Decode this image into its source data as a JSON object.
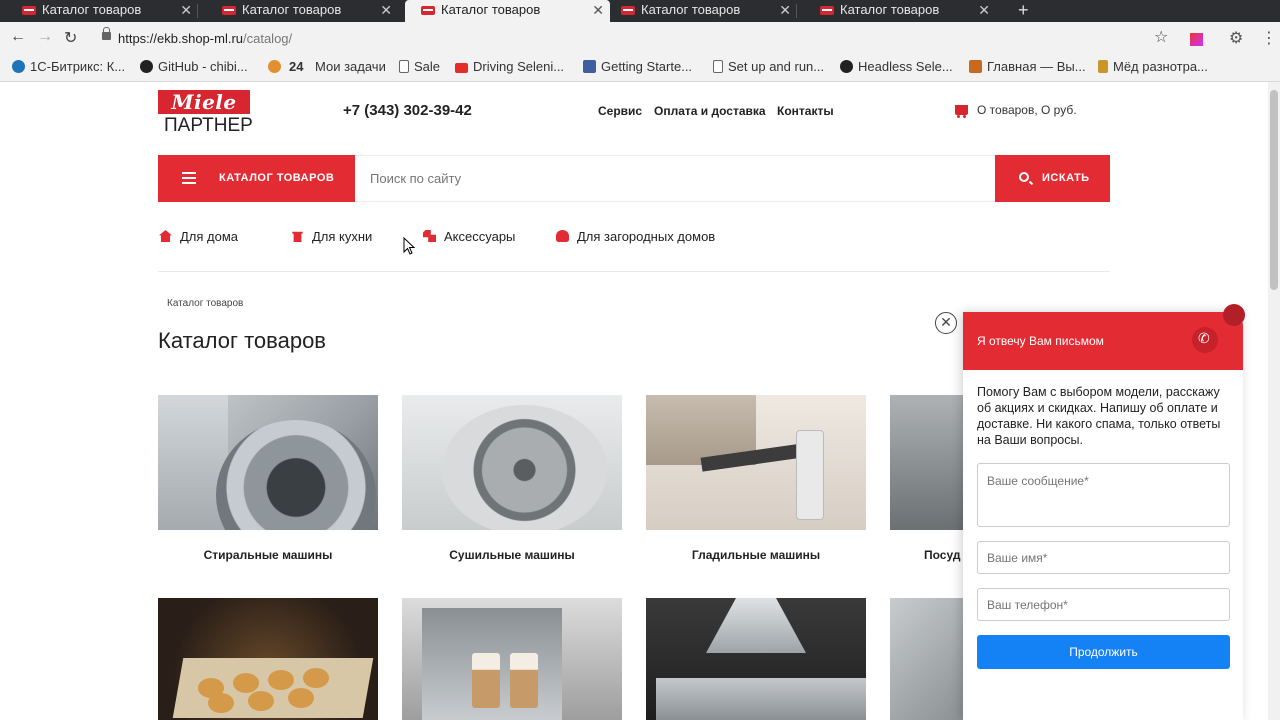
{
  "browser": {
    "tabs": [
      {
        "label": "Каталог товаров",
        "active": false
      },
      {
        "label": "Каталог товаров",
        "active": false
      },
      {
        "label": "Каталог товаров",
        "active": true
      },
      {
        "label": "Каталог товаров",
        "active": false
      },
      {
        "label": "Каталог товаров",
        "active": false
      }
    ],
    "new_tab": "+",
    "url_host": "https://ekb.shop-ml.ru",
    "url_path": "/catalog/",
    "bookmarks": [
      {
        "label": "1С-Битрикс: К...",
        "icon": "bitrix-icon",
        "color": "#1e74b8"
      },
      {
        "label": "GitHub - chibi...",
        "icon": "github-icon",
        "color": "#222222"
      },
      {
        "label": "24",
        "icon": "burger-icon",
        "color": "#e38f2f"
      },
      {
        "label": "Мои задачи",
        "icon": "",
        "color": ""
      },
      {
        "label": "Sale",
        "icon": "page-icon",
        "color": "#ffffff"
      },
      {
        "label": "Driving Seleni...",
        "icon": "youtube-icon",
        "color": "#e52d27"
      },
      {
        "label": "Getting Starte...",
        "icon": "doc-icon",
        "color": "#3f5e9d"
      },
      {
        "label": "Set up and run...",
        "icon": "page-icon",
        "color": "#ffffff"
      },
      {
        "label": "Headless Sele...",
        "icon": "github-icon",
        "color": "#222222"
      },
      {
        "label": "Главная — Вы...",
        "icon": "food-icon",
        "color": "#c76a1f"
      },
      {
        "label": "Мёд разнотра...",
        "icon": "honey-icon",
        "color": "#c9962a"
      }
    ]
  },
  "header": {
    "logo_brand": "Miele",
    "logo_sub": "ПАРТНЕР",
    "phone": "+7 (343) 302-39-42",
    "nav": [
      "Сервис",
      "Оплата и доставка",
      "Контакты"
    ],
    "cart": "О товаров, О руб."
  },
  "search": {
    "catalog_button": "КАТАЛОГ ТОВАРОВ",
    "placeholder": "Поиск по сайту",
    "button": "ИСКАТЬ"
  },
  "subnav": [
    {
      "label": "Для дома",
      "icon": "home-icon"
    },
    {
      "label": "Для кухни",
      "icon": "pot-icon"
    },
    {
      "label": "Аксессуары",
      "icon": "accessory-icon"
    },
    {
      "label": "Для загородных домов",
      "icon": "tree-icon"
    }
  ],
  "breadcrumb": "Каталог товаров",
  "page_title": "Каталог товаров",
  "catalog": [
    {
      "label": "Стиральные машины"
    },
    {
      "label": "Сушильные машины"
    },
    {
      "label": "Гладильные машины"
    },
    {
      "label": "Посуд"
    }
  ],
  "popup": {
    "title": "Я отвечу Вам письмом",
    "text": "Помогу Вам с выбором модели, расскажу об акциях и скидках. Напишу об оплате и доставке. Ни какого спама, только ответы на Ваши вопросы.",
    "message_placeholder": "Ваше сообщение*",
    "name_placeholder": "Ваше имя*",
    "phone_placeholder": "Ваш телефон*",
    "submit": "Продолжить"
  },
  "colors": {
    "brand_red": "#e32b33",
    "submit_blue": "#1481f5"
  }
}
